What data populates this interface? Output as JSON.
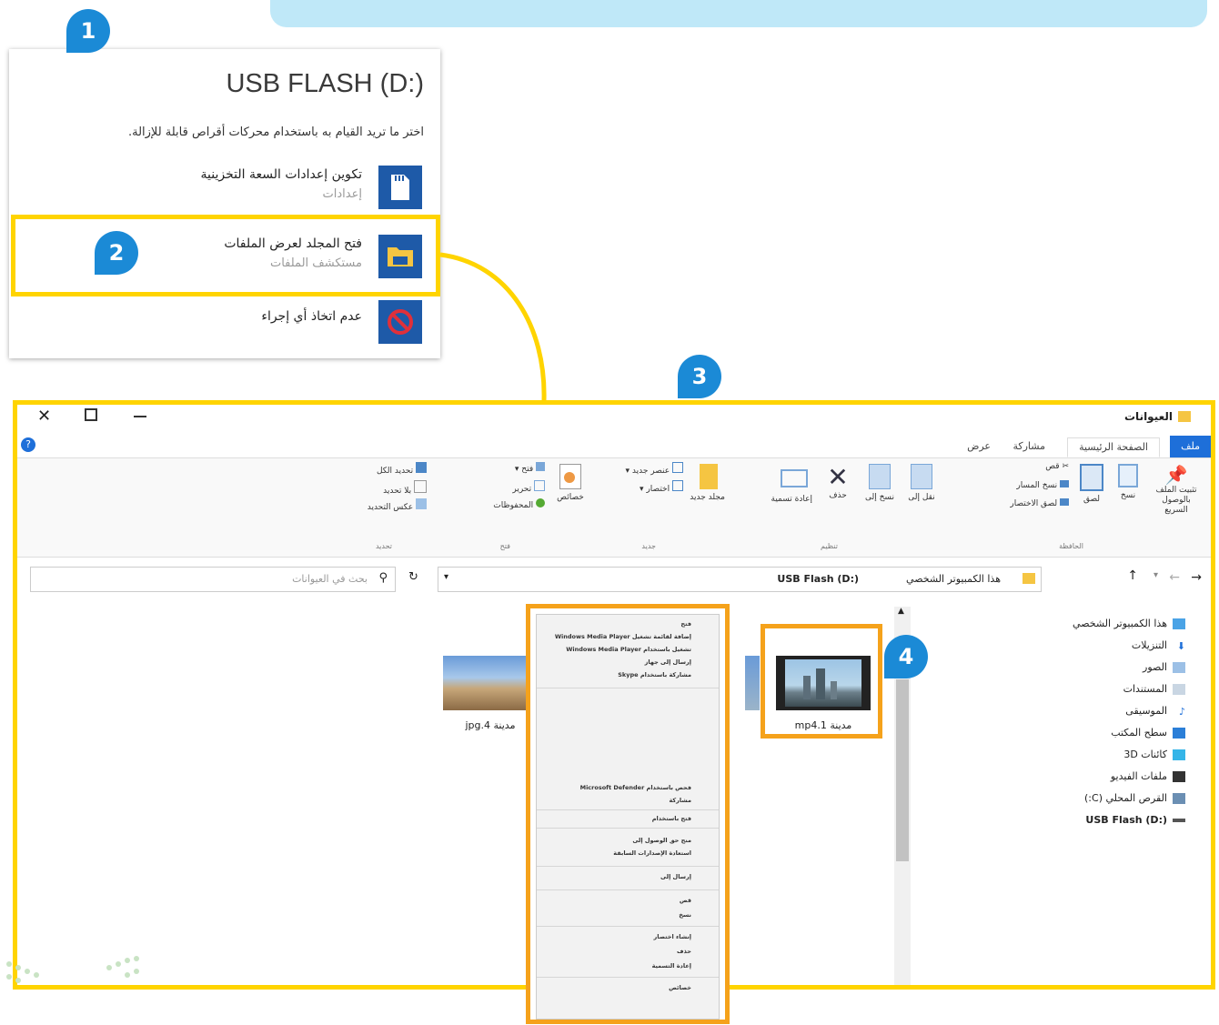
{
  "badges": [
    "1",
    "2",
    "3",
    "4"
  ],
  "autoplay": {
    "title": "USB FLASH (D:)",
    "subtitle": "اختر ما تريد القيام به باستخدام محركات أقراص قابلة للإزالة.",
    "options": [
      {
        "title": "تكوين إعدادات السعة التخزينية",
        "subtitle": "إعدادات",
        "icon": "sd-card-icon"
      },
      {
        "title": "فتح المجلد لعرض الملفات",
        "subtitle": "مستكشف الملفات",
        "icon": "folder-icon"
      },
      {
        "title": "عدم اتخاذ أي إجراء",
        "subtitle": "",
        "icon": "no-action-icon"
      }
    ]
  },
  "explorer": {
    "title": "العيوانات",
    "tabs": [
      "ملف",
      "الصفحة الرئيسية",
      "مشاركة",
      "عرض"
    ],
    "ribbon": {
      "pin": "تثبيت الملف بالوصول السريع",
      "copy": "نسخ",
      "paste": "لصق",
      "cut": "قص",
      "copy_path": "نسخ المسار",
      "paste_shortcut": "لصق الاختصار",
      "move_to": "نقل إلى",
      "copy_to": "نسخ إلى",
      "delete": "حذف",
      "rename": "إعادة تسمية",
      "new_folder": "مجلد جديد",
      "new_item": "عنصر جديد",
      "easy_access": "اختصار",
      "properties": "خصائص",
      "open": "فتح",
      "edit": "تحرير",
      "history": "المحفوظات",
      "select_all": "تحديد الكل",
      "select_none": "بلا تحديد",
      "invert_selection": "عكس التحديد",
      "groups": [
        "الحافظة",
        "تنظيم",
        "جديد",
        "فتح",
        "تحديد"
      ]
    },
    "breadcrumb": [
      "هذا الكمبيوتر الشخصي",
      "USB Flash (D:)"
    ],
    "search_placeholder": "بحث في العيوانات",
    "nav": [
      {
        "label": "هذا الكمبيوتر الشخصي",
        "icon": "computer-icon"
      },
      {
        "label": "التنزيلات",
        "icon": "download-icon"
      },
      {
        "label": "الصور",
        "icon": "pictures-icon"
      },
      {
        "label": "المستندات",
        "icon": "documents-icon"
      },
      {
        "label": "الموسيقى",
        "icon": "music-icon"
      },
      {
        "label": "سطح المكتب",
        "icon": "desktop-icon"
      },
      {
        "label": "كائنات 3D",
        "icon": "3d-objects-icon"
      },
      {
        "label": "ملفات الفيديو",
        "icon": "videos-icon"
      },
      {
        "label": "القرص المحلي (C:)",
        "icon": "drive-icon"
      },
      {
        "label": "USB Flash (D:)",
        "icon": "usb-icon"
      }
    ],
    "files": [
      {
        "name": "مدينة 1.mp4",
        "icon": "video-file-icon"
      },
      {
        "name": "مدينة 4.jpg"
      }
    ]
  },
  "context_menu": {
    "items": [
      "فتح",
      "إضافة لقائمة تشغيل Windows Media Player",
      "تشغيل باستخدام Windows Media Player",
      "إرسال إلى جهاز",
      "مشاركة باستخدام Skype",
      "فحص باستخدام Microsoft Defender",
      "مشاركة",
      "فتح باستخدام",
      "منح حق الوصول إلى",
      "استعادة الإصدارات السابقة",
      "إرسال إلى",
      "قص",
      "نسخ",
      "إنشاء اختصار",
      "حذف",
      "إعادة التسمية",
      "خصائص"
    ]
  }
}
